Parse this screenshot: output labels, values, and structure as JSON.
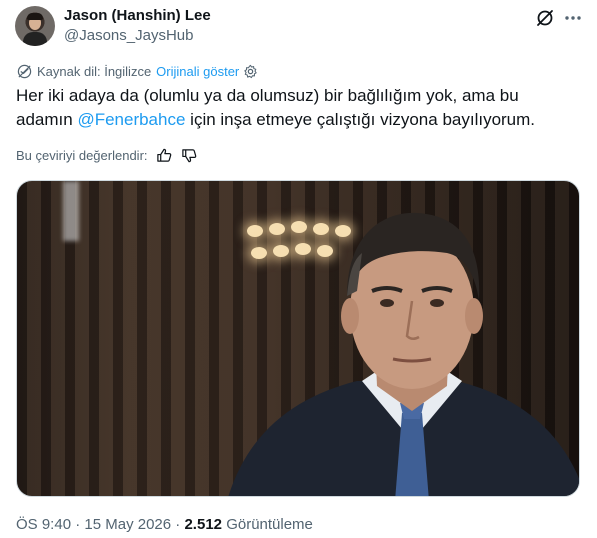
{
  "author": {
    "name": "Jason (Hanshin) Lee",
    "handle": "@Jasons_JaysHub"
  },
  "icons": {
    "grok": "grok-slash-icon",
    "more": "more-dots-icon",
    "globe": "globe-icon",
    "settings": "gear-icon",
    "like": "thumbs-up-icon",
    "dislike": "thumbs-down-icon"
  },
  "translation": {
    "source_label": "Kaynak dil: İngilizce",
    "show_original": "Orijinali göster"
  },
  "tweet": {
    "text_before": "Her iki adaya da (olumlu ya da olumsuz) bir bağlılığım yok, ama bu adamın ",
    "mention": "@Fenerbahce",
    "text_after": " için inşa etmeye çalıştığı vizyona bayılıyorum."
  },
  "rate": {
    "label": "Bu çeviriyi değerlendir:"
  },
  "meta": {
    "time": "ÖS 9:40",
    "date": "15 May 2026",
    "separator": " · ",
    "views_count": "2.512",
    "views_label": "Görüntüleme"
  },
  "colors": {
    "accent": "#1d9bf0",
    "secondary_text": "#536471",
    "primary_text": "#0f1419",
    "border": "#cfd9de"
  }
}
